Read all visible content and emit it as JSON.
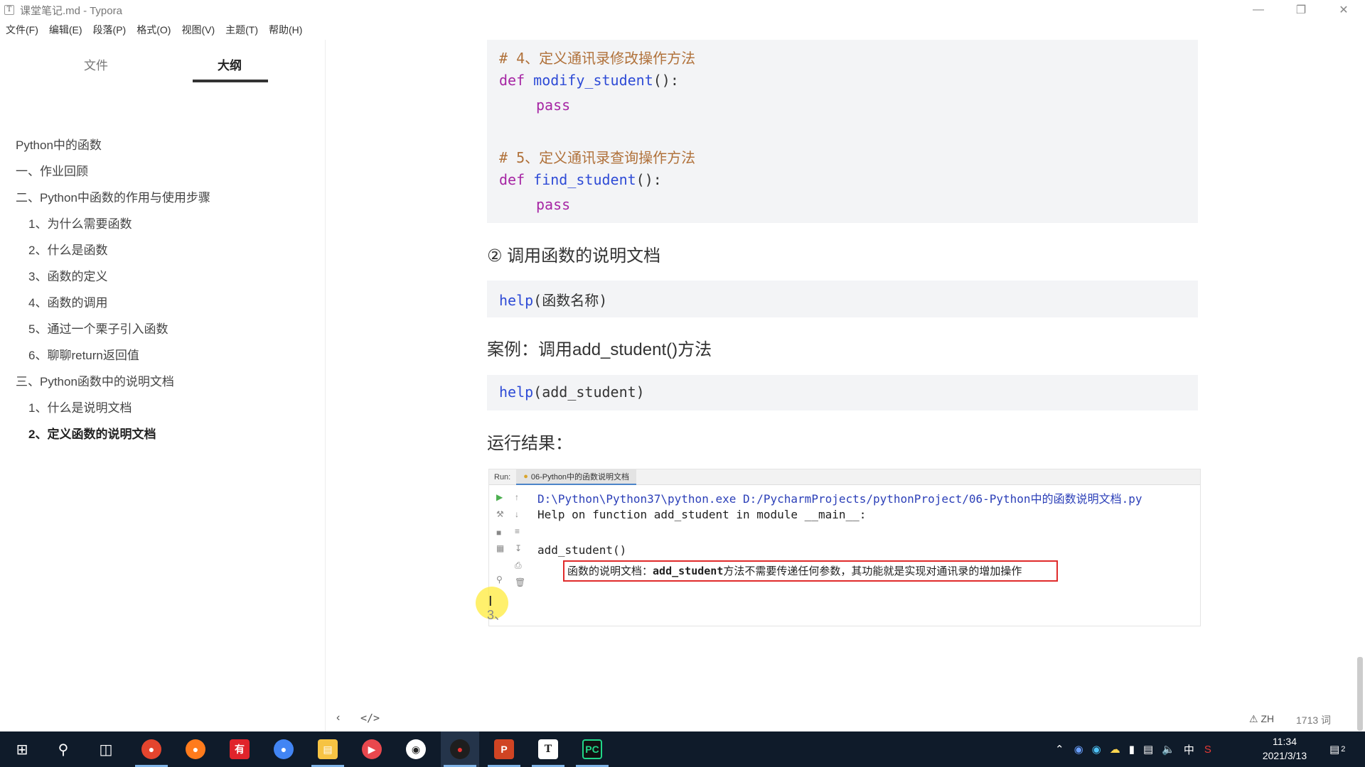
{
  "window": {
    "title": "课堂笔记.md - Typora",
    "app_icon": "T"
  },
  "menu": [
    "文件(F)",
    "编辑(E)",
    "段落(P)",
    "格式(O)",
    "视图(V)",
    "主题(T)",
    "帮助(H)"
  ],
  "sidebar": {
    "tab_files": "文件",
    "tab_outline": "大纲",
    "items": [
      "Python中的函数",
      "一、作业回顾",
      "二、Python中函数的作用与使用步骤",
      "1、为什么需要函数",
      "2、什么是函数",
      "3、函数的定义",
      "4、函数的调用",
      "5、通过一个栗子引入函数",
      "6、聊聊return返回值",
      "三、Python函数中的说明文档",
      "1、什么是说明文档",
      "2、定义函数的说明文档"
    ]
  },
  "code1": {
    "comment1": "# 4、定义通讯录修改操作方法",
    "def1_kw": "def",
    "def1_fn": "modify_student",
    "def1_rest": "():",
    "pass1": "pass",
    "comment2": "# 5、定义通讯录查询操作方法",
    "def2_kw": "def",
    "def2_fn": "find_student",
    "def2_rest": "():",
    "pass2": "pass"
  },
  "heading_doc": "② 调用函数的说明文档",
  "code2": {
    "fn": "help",
    "rest": "(函数名称)"
  },
  "heading_case": "案例：调用add_student()方法",
  "code3": {
    "fn": "help",
    "rest": "(add_student)"
  },
  "heading_result": "运行结果：",
  "run": {
    "label": "Run:",
    "tab": "06-Python中的函数说明文档",
    "line1": "D:\\Python\\Python37\\python.exe D:/PycharmProjects/pythonProject/06-Python中的函数说明文档.py",
    "line2": "Help on function add_student in module __main__:",
    "line3": "add_student()",
    "doc_prefix": "函数的说明文档：",
    "doc_name": "add_student",
    "doc_suffix": "方法不需要传递任何参数，其功能就是实现对通讯录的增加操作"
  },
  "partial_text": "3、",
  "footer": {
    "back": "‹",
    "code": "</>",
    "lang": "ZH",
    "words": "1713 词"
  },
  "taskbar": {
    "time": "11:34",
    "date": "2021/3/13",
    "ime": "中",
    "notification_count": "2"
  },
  "colors": {
    "keyword": "#a626a4",
    "function": "#2e4bd6",
    "comment": "#b0713a",
    "code_bg": "#f3f4f6",
    "taskbar": "#0f1b2a",
    "highlight_box": "#e02b2b"
  }
}
